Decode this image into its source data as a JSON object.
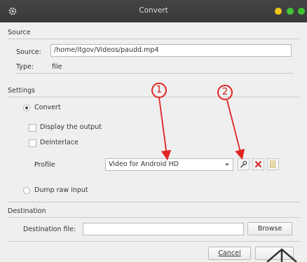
{
  "window": {
    "title": "Convert",
    "controls": [
      "minimize",
      "maximize",
      "close"
    ]
  },
  "source": {
    "section_label": "Source",
    "source_label": "Source:",
    "source_path": "/home/itgov/Videos/paudd.mp4",
    "type_label": "Type:",
    "type_value": "file"
  },
  "settings": {
    "section_label": "Settings",
    "convert_label": "Convert",
    "convert_selected": true,
    "display_output_label": "Display the output",
    "display_output_checked": false,
    "deinterlace_label": "Deinterlace",
    "deinterlace_checked": false,
    "profile_label": "Profile",
    "profile_value": "Video for Android HD",
    "dump_raw_label": "Dump raw input",
    "dump_raw_selected": false
  },
  "destination": {
    "section_label": "Destination",
    "file_label": "Destination file:",
    "file_value": "",
    "browse_label": "Browse"
  },
  "buttons": {
    "cancel_label": "Cancel",
    "start_label": "Start"
  },
  "annotations": {
    "callout_1": "1",
    "callout_2": "2",
    "color": "#e02424"
  },
  "icons": {
    "title_icon": "gear-icon",
    "edit_profile": "wrench-icon",
    "delete_profile": "delete-x-icon",
    "new_profile": "new-profile-icon",
    "dropdown": "chevron-down-icon"
  }
}
